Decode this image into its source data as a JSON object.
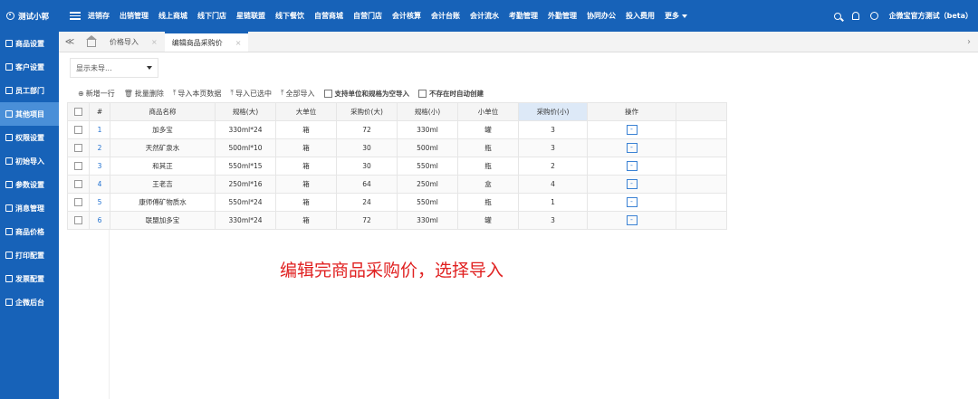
{
  "app": {
    "brand": "测试小郭",
    "nav": [
      "进销存",
      "出销管理",
      "线上商城",
      "线下门店",
      "星链联盟",
      "线下餐饮",
      "自营商城",
      "自营门店",
      "会计核算",
      "会计台账",
      "会计流水",
      "考勤管理",
      "外勤管理",
      "协同办公",
      "投入费用"
    ],
    "more": "更多",
    "user": "企微宝官方测试（beta）"
  },
  "sidebar": {
    "items": [
      {
        "label": "商品设置",
        "icon": "settings-icon"
      },
      {
        "label": "客户设置",
        "icon": "settings-icon"
      },
      {
        "label": "员工部门",
        "icon": "settings-icon"
      },
      {
        "label": "其他项目",
        "icon": "folder-icon",
        "active": true
      },
      {
        "label": "权限设置",
        "icon": "shield-icon"
      },
      {
        "label": "初始导入",
        "icon": "import-icon"
      },
      {
        "label": "参数设置",
        "icon": "sliders-icon"
      },
      {
        "label": "消息管理",
        "icon": "message-icon"
      },
      {
        "label": "商品价格",
        "icon": "settings-icon"
      },
      {
        "label": "打印配置",
        "icon": "settings-icon"
      },
      {
        "label": "发票配置",
        "icon": "settings-icon"
      },
      {
        "label": "企微后台",
        "icon": "settings-icon"
      }
    ]
  },
  "tabs": [
    {
      "label": "价格导入",
      "active": false
    },
    {
      "label": "编辑商品采购价",
      "active": true
    }
  ],
  "filter": {
    "value": "显示未导..."
  },
  "toolbar": {
    "add_row": "新增一行",
    "batch_delete": "批量删除",
    "import_page": "导入本页数据",
    "import_selected": "导入已选中",
    "import_all": "全部导入",
    "allow_empty": "支持单位和规格为空导入",
    "auto_create": "不存在时自动创建"
  },
  "table": {
    "headers": [
      "#",
      "商品名称",
      "规格(大)",
      "大单位",
      "采购价(大)",
      "规格(小)",
      "小单位",
      "采购价(小)",
      "操作"
    ],
    "rows": [
      [
        "1",
        "加多宝",
        "330ml*24",
        "箱",
        "72",
        "330ml",
        "罐",
        "3"
      ],
      [
        "2",
        "天然矿泉水",
        "500ml*10",
        "箱",
        "30",
        "500ml",
        "瓶",
        "3"
      ],
      [
        "3",
        "和其正",
        "550ml*15",
        "箱",
        "30",
        "550ml",
        "瓶",
        "2"
      ],
      [
        "4",
        "王老吉",
        "250ml*16",
        "箱",
        "64",
        "250ml",
        "盒",
        "4"
      ],
      [
        "5",
        "康师傅矿物质水",
        "550ml*24",
        "箱",
        "24",
        "550ml",
        "瓶",
        "1"
      ],
      [
        "6",
        "联盟加多宝",
        "330ml*24",
        "箱",
        "72",
        "330ml",
        "罐",
        "3"
      ]
    ],
    "op_symbol": "-"
  },
  "annotation": "编辑完商品采购价，选择导入"
}
